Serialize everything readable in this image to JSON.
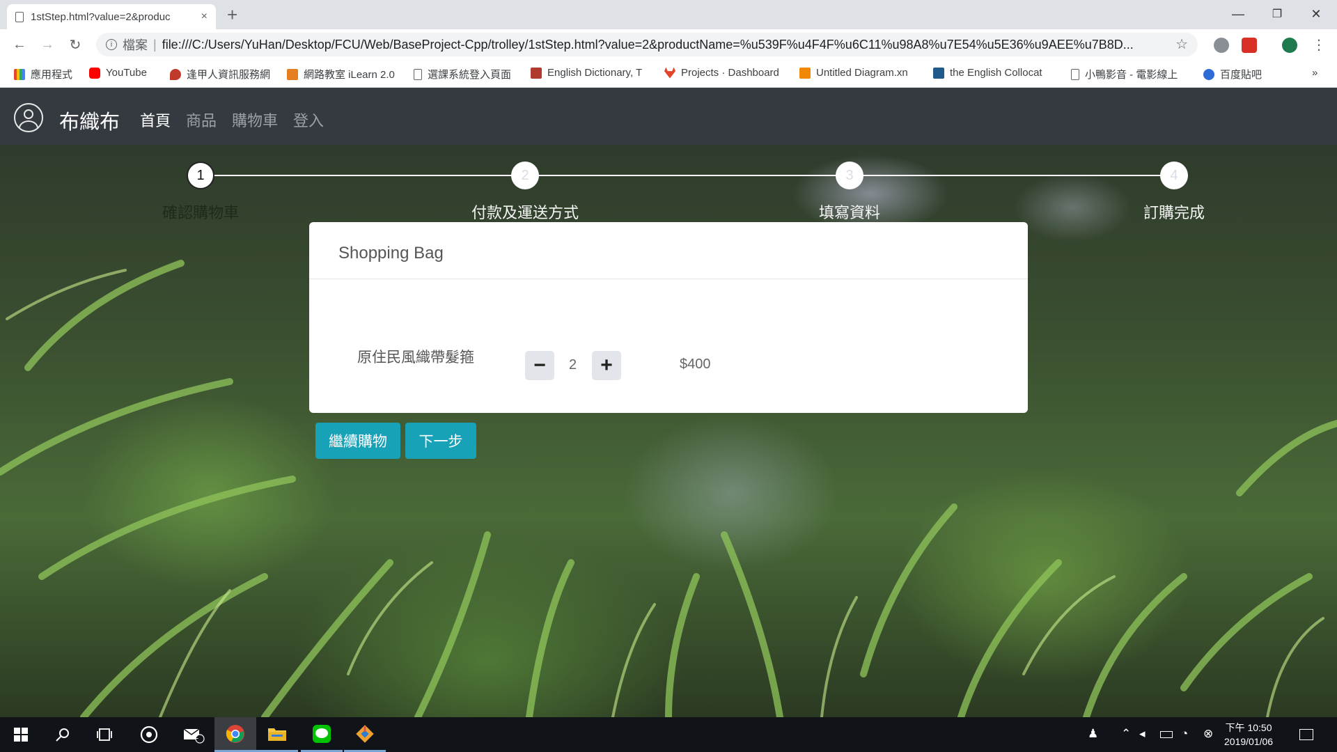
{
  "browser": {
    "tab_title": "1stStep.html?value=2&produc",
    "tab_close": "×",
    "new_tab": "+",
    "url_scheme": "檔案",
    "url_sep": "|",
    "url": "file:///C:/Users/YuHan/Desktop/FCU/Web/BaseProject-Cpp/trolley/1stStep.html?value=2&productName=%u539F%u4F4F%u6C11%u98A8%u7E54%u5E36%u9AEE%u7B8D...",
    "window_controls": {
      "minimize": "—",
      "restore": "❐",
      "close": "✕"
    },
    "nav_icons": {
      "back": "←",
      "forward": "→",
      "reload": "↻",
      "info": "i",
      "bookmark_star": "☆",
      "menu": "⋮"
    },
    "bookmarks": [
      {
        "label": "應用程式",
        "icon": "apps-grid-icon",
        "color": "#ea4335"
      },
      {
        "label": "YouTube",
        "icon": "youtube-icon",
        "color": "#ff0000"
      },
      {
        "label": "逢甲人資訊服務網",
        "icon": "fcu-icon",
        "color": "#c0392b"
      },
      {
        "label": "網路教室 iLearn 2.0",
        "icon": "ilearn-icon",
        "color": "#e67e22"
      },
      {
        "label": "選課系統登入頁面",
        "icon": "page-icon",
        "color": "#5f6368"
      },
      {
        "label": "English Dictionary, T",
        "icon": "dictionary-icon",
        "color": "#b03a2e"
      },
      {
        "label": "Projects · Dashboard",
        "icon": "gitlab-icon",
        "color": "#e24329"
      },
      {
        "label": "Untitled Diagram.xn",
        "icon": "drawio-icon",
        "color": "#f08705"
      },
      {
        "label": "the English Collocat",
        "icon": "oz-icon",
        "color": "#1f5a8b"
      },
      {
        "label": "小鴨影音 - 電影線上",
        "icon": "page-icon",
        "color": "#5f6368"
      },
      {
        "label": "百度貼吧",
        "icon": "baidu-icon",
        "color": "#2d6bd6"
      }
    ],
    "bookmarks_more": "»"
  },
  "site": {
    "brand": "布織布",
    "nav": [
      {
        "label": "首頁",
        "active": true
      },
      {
        "label": "商品",
        "active": false
      },
      {
        "label": "購物車",
        "active": false
      },
      {
        "label": "登入",
        "active": false
      }
    ]
  },
  "stepper": {
    "current_step": 1,
    "steps": [
      {
        "number": "1",
        "label": "確認購物車"
      },
      {
        "number": "2",
        "label": "付款及運送方式"
      },
      {
        "number": "3",
        "label": "填寫資料"
      },
      {
        "number": "4",
        "label": "訂購完成"
      }
    ]
  },
  "cart": {
    "title": "Shopping Bag",
    "items": [
      {
        "name": "原住民風織帶髮箍",
        "quantity": "2",
        "price": "$400"
      }
    ],
    "minus_label": "−",
    "plus_label": "+"
  },
  "actions": {
    "continue_shopping": "繼續購物",
    "next_step": "下一步"
  },
  "taskbar": {
    "mail_badge": "2",
    "clock_time": "下午 10:50",
    "clock_date": "2019/01/06"
  },
  "colors": {
    "navbar": "#343a40",
    "button_teal": "#17a2b8",
    "card_bg": "#ffffff"
  }
}
